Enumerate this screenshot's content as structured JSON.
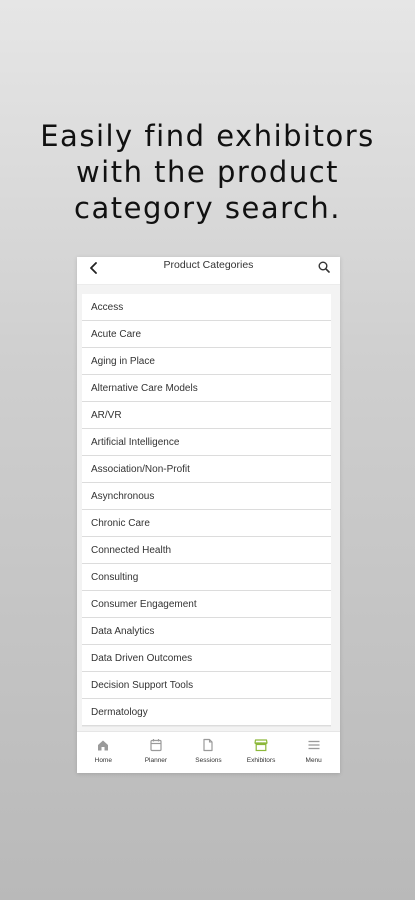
{
  "headline": [
    "Easily find exhibitors",
    "with the product",
    "category search."
  ],
  "topbar": {
    "title": "Product Categories"
  },
  "categories": [
    "Access",
    "Acute Care",
    "Aging in Place",
    "Alternative Care Models",
    "AR/VR",
    "Artificial Intelligence",
    "Association/Non-Profit",
    "Asynchronous",
    "Chronic Care",
    "Connected Health",
    "Consulting",
    "Consumer Engagement",
    "Data Analytics",
    "Data Driven Outcomes",
    "Decision Support Tools",
    "Dermatology"
  ],
  "tabs": [
    {
      "label": "Home",
      "icon": "home-icon",
      "active": false
    },
    {
      "label": "Planner",
      "icon": "calendar-icon",
      "active": false
    },
    {
      "label": "Sessions",
      "icon": "document-icon",
      "active": false
    },
    {
      "label": "Exhibitors",
      "icon": "storefront-icon",
      "active": true
    },
    {
      "label": "Menu",
      "icon": "hamburger-icon",
      "active": false
    }
  ],
  "colors": {
    "accent": "#8cb83a",
    "icon": "#9a9a9a"
  }
}
